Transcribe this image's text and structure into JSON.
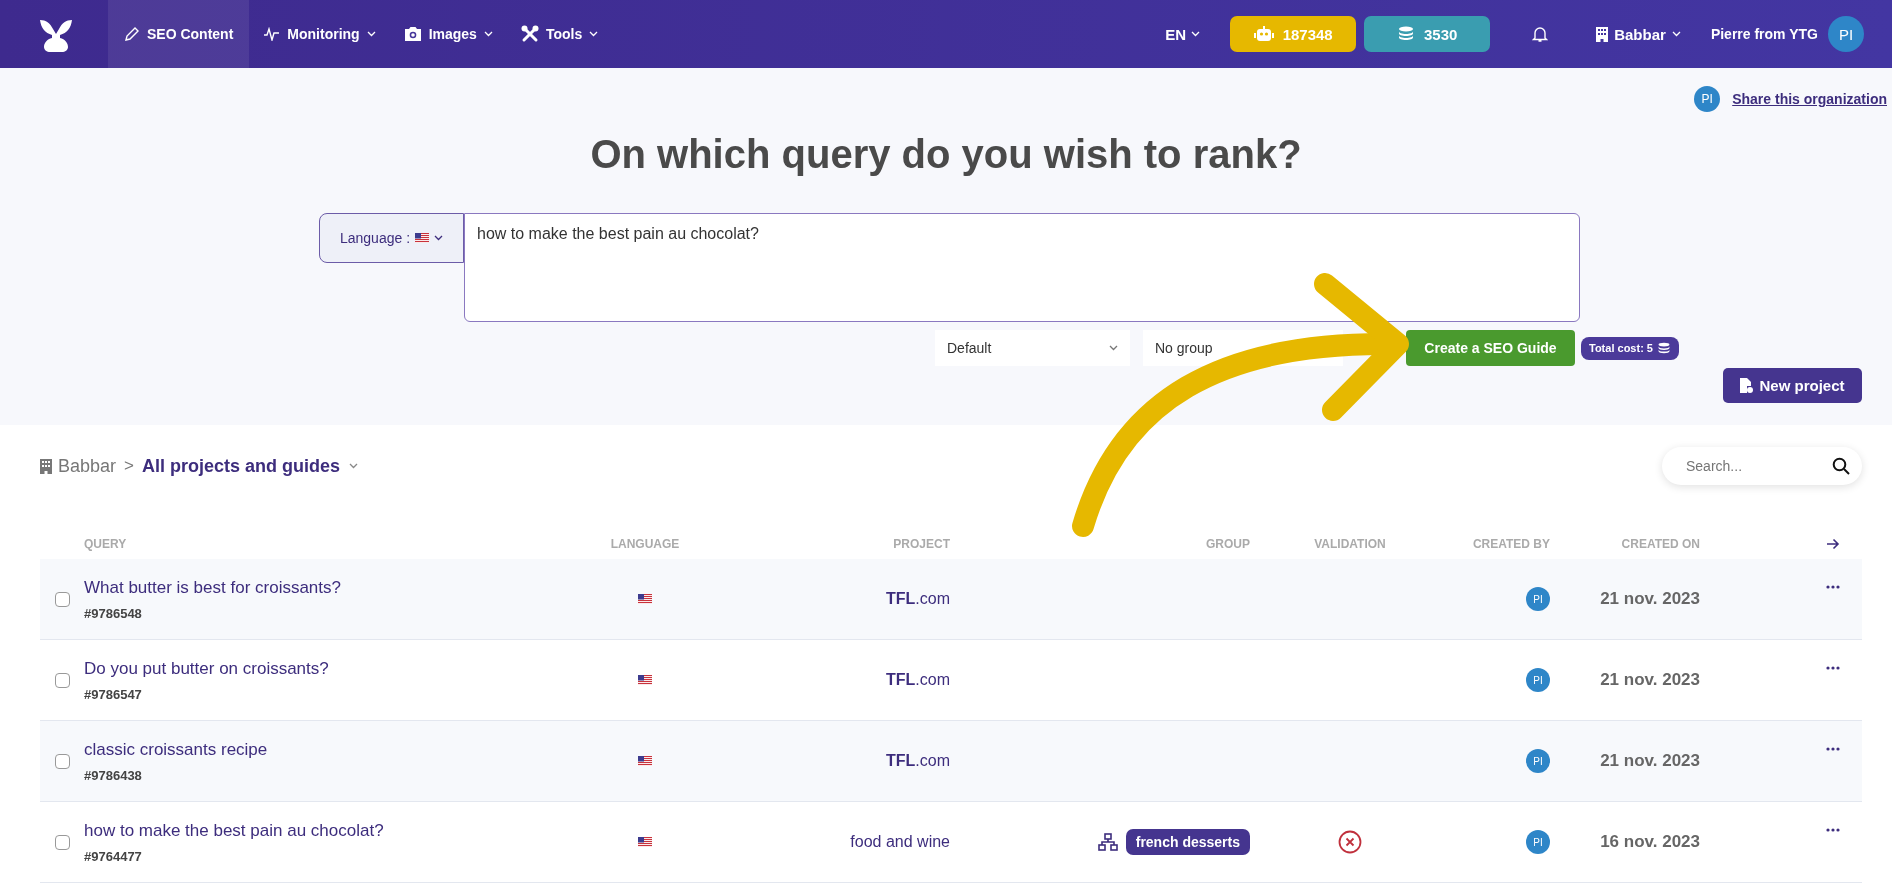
{
  "nav": {
    "items": [
      {
        "label": "SEO Content",
        "kind": "pencil",
        "selected": true,
        "has_menu": false
      },
      {
        "label": "Monitoring",
        "kind": "pulse",
        "selected": false,
        "has_menu": true
      },
      {
        "label": "Images",
        "kind": "camera",
        "selected": false,
        "has_menu": true
      },
      {
        "label": "Tools",
        "kind": "tools",
        "selected": false,
        "has_menu": true
      }
    ],
    "language": "EN",
    "credits": [
      {
        "kind": "robot",
        "value": "187348",
        "color": "#e6b800"
      },
      {
        "kind": "coins",
        "value": "3530",
        "color": "#3a9db0"
      }
    ],
    "organization": "Babbar",
    "user": "Pierre from YTG",
    "avatar": "PI"
  },
  "share": {
    "avatar": "PI",
    "label": "Share this organization"
  },
  "heading": "On which query do you wish to rank?",
  "query_form": {
    "language_label": "Language :",
    "value": "how to make the best pain au chocolat?",
    "mode": "Default",
    "group": "No group",
    "submit": "Create a SEO Guide",
    "cost": "Total cost: 5"
  },
  "new_project": "New project",
  "breadcrumb": {
    "organization": "Babbar",
    "separator": ">",
    "current": "All projects and guides"
  },
  "search": {
    "placeholder": "Search..."
  },
  "table": {
    "columns": [
      "QUERY",
      "LANGUAGE",
      "PROJECT",
      "GROUP",
      "VALIDATION",
      "CREATED BY",
      "CREATED ON"
    ],
    "rows": [
      {
        "checked": false,
        "title": "What butter is best for croissants?",
        "id": "#9786548",
        "project": "**TFL**.com",
        "rejected": false,
        "created_by": "PI",
        "created_on": "21 nov. 2023"
      },
      {
        "checked": false,
        "title": "Do you put butter on croissants?",
        "id": "#9786547",
        "project": "**TFL**.com",
        "rejected": false,
        "created_by": "PI",
        "created_on": "21 nov. 2023"
      },
      {
        "checked": false,
        "title": "classic croissants recipe",
        "id": "#9786438",
        "project": "**TFL**.com",
        "rejected": false,
        "created_by": "PI",
        "created_on": "21 nov. 2023"
      },
      {
        "checked": false,
        "title": "how to make the best pain au chocolat?",
        "id": "#9764477",
        "project": "food and wine",
        "group": "french desserts",
        "rejected": true,
        "created_by": "PI",
        "created_on": "16 nov. 2023"
      }
    ]
  }
}
